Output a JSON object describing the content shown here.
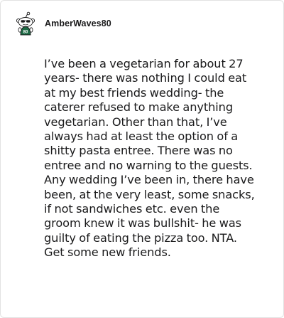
{
  "comment": {
    "author": "AmberWaves80",
    "avatar_icon": "snoo-avatar-icon",
    "avatar_badge": "80",
    "body": "I’ve been a vegetarian for about 27 years- there was nothing I could eat at my best friends wedding- the caterer refused to make anything vegetarian. Other than that, I’ve always had at least the option of a shitty pasta entree. There was no entree and no warning to the guests. Any wedding I’ve been in, there have been, at the very least, some snacks, if not sandwiches etc. even the groom knew it was bullshit- he was guilty of eating the pizza too. NTA. Get some new friends."
  },
  "colors": {
    "text": "#1a1a1b",
    "card_border": "#e2e2e2",
    "avatar_accent": "#1d6b45"
  }
}
